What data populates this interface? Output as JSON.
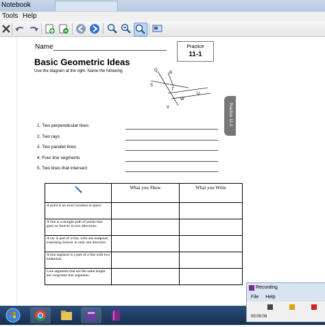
{
  "window": {
    "title": "Notebook"
  },
  "menu": [
    "Tools",
    "Help"
  ],
  "toolbar": {
    "icons": [
      "delete-icon",
      "undo-icon",
      "redo-icon",
      "add-page-icon",
      "insert-page-icon",
      "back-icon",
      "forward-icon",
      "zoom-in-icon",
      "zoom-out-icon",
      "zoom-fit-icon",
      "screen-icon"
    ]
  },
  "worksheet": {
    "name_label": "Name",
    "practice_label": "Practice",
    "practice_number": "11-1",
    "title": "Basic Geometric Ideas",
    "instructions": "Use the diagram at the right. Name the following.",
    "side_tab": "Practice 11-1",
    "diagram_labels": [
      "Q",
      "R",
      "S",
      "T",
      "U",
      "W",
      "V"
    ],
    "questions": [
      {
        "num": "1.",
        "text": "Two perpendicular lines"
      },
      {
        "num": "2.",
        "text": "Two rays"
      },
      {
        "num": "3.",
        "text": "Two parallel lines"
      },
      {
        "num": "4.",
        "text": "Four line segments"
      },
      {
        "num": "5.",
        "text": "Two lines that intersect"
      }
    ],
    "table": {
      "headers": [
        "",
        "What you Show",
        "What you Write"
      ],
      "rows": [
        "A point is an exact location in space.",
        "A line is a straight path of points that goes on forever in two directions.",
        "A ray is part of a line, with one endpoint, extending forever in only one direction.",
        "A line segment is a part of a line with two endpoints.",
        "Line segments that are the same length are congruent line segments."
      ]
    }
  },
  "recorder": {
    "title": "Recording",
    "menu": [
      "File",
      "Help"
    ],
    "time": "00:00:09",
    "colors": {
      "pause": "#e0a200",
      "stop": "#d42020"
    }
  }
}
